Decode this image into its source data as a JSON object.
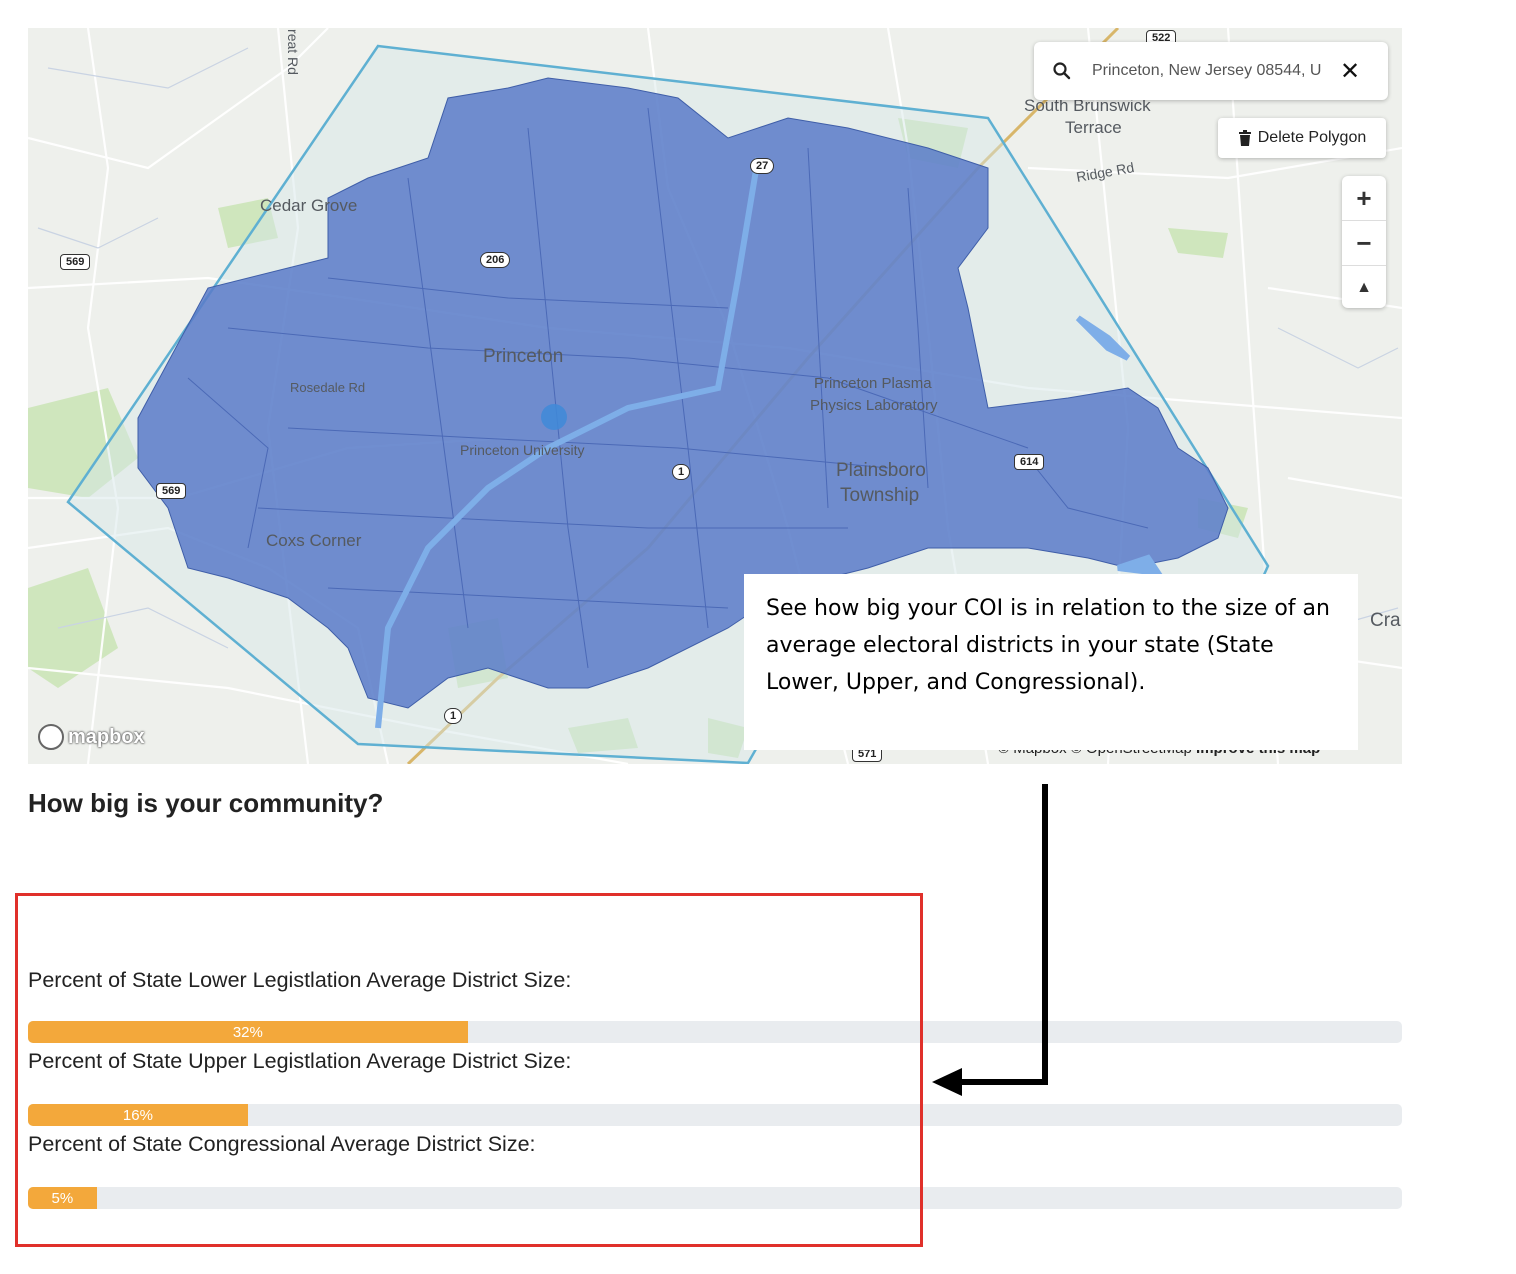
{
  "map": {
    "place_labels": [
      {
        "id": "cedar-grove",
        "text": "Cedar Grove"
      },
      {
        "id": "princeton",
        "text": "Princeton"
      },
      {
        "id": "princeton-university",
        "text": "Princeton University"
      },
      {
        "id": "rosedale-rd",
        "text": "Rosedale Rd"
      },
      {
        "id": "coxs-corner",
        "text": "Coxs Corner"
      },
      {
        "id": "pppl-1",
        "text": "Princeton Plasma"
      },
      {
        "id": "pppl-2",
        "text": "Physics Laboratory"
      },
      {
        "id": "plainsboro-1",
        "text": "Plainsboro"
      },
      {
        "id": "plainsboro-2",
        "text": "Township"
      },
      {
        "id": "sb-terrace-1",
        "text": "South Brunswick"
      },
      {
        "id": "sb-terrace-2",
        "text": "Terrace"
      },
      {
        "id": "ridge-rd",
        "text": "Ridge Rd"
      },
      {
        "id": "reat-rd",
        "text": "reat Rd"
      },
      {
        "id": "cra",
        "text": "Cra"
      }
    ],
    "route_shields": [
      {
        "id": "569-top",
        "text": "569"
      },
      {
        "id": "569-bottom",
        "text": "569"
      },
      {
        "id": "206",
        "text": "206"
      },
      {
        "id": "522",
        "text": "522"
      },
      {
        "id": "614",
        "text": "614"
      },
      {
        "id": "571",
        "text": "571"
      },
      {
        "id": "1-top",
        "text": "1"
      },
      {
        "id": "1-bottom",
        "text": "1"
      },
      {
        "id": "27",
        "text": "27"
      }
    ],
    "search": {
      "value": "Princeton, New Jersey 08544, U"
    },
    "search_close": "✕",
    "delete_polygon_label": "Delete Polygon",
    "zoom_in": "+",
    "zoom_out": "−",
    "compass": "▲",
    "mapbox_logo": "mapbox",
    "attribution": "© Mapbox © OpenStreetMap",
    "attribution_improve": "Improve this map",
    "colors": {
      "polygon_fill": "#5b7bc9",
      "polygon_outline": "#5fb0d2",
      "water": "#7eaee8"
    }
  },
  "callout": {
    "text": "See how big your COI is in relation to the size of an average electoral districts in your state (State Lower, Upper, and Congressional)."
  },
  "section_title": "How big is your community?",
  "bars": [
    {
      "label": "Percent of State Lower Legistlation Average District Size:",
      "value": 32,
      "display": "32%"
    },
    {
      "label": "Percent of State Upper Legistlation Average District Size:",
      "value": 16,
      "display": "16%"
    },
    {
      "label": "Percent of State Congressional Average District Size:",
      "value": 5,
      "display": "5%"
    }
  ],
  "colors": {
    "bar_fill": "#f3a83b",
    "bar_track": "#e9ecef",
    "highlight_box": "#e0302a"
  }
}
